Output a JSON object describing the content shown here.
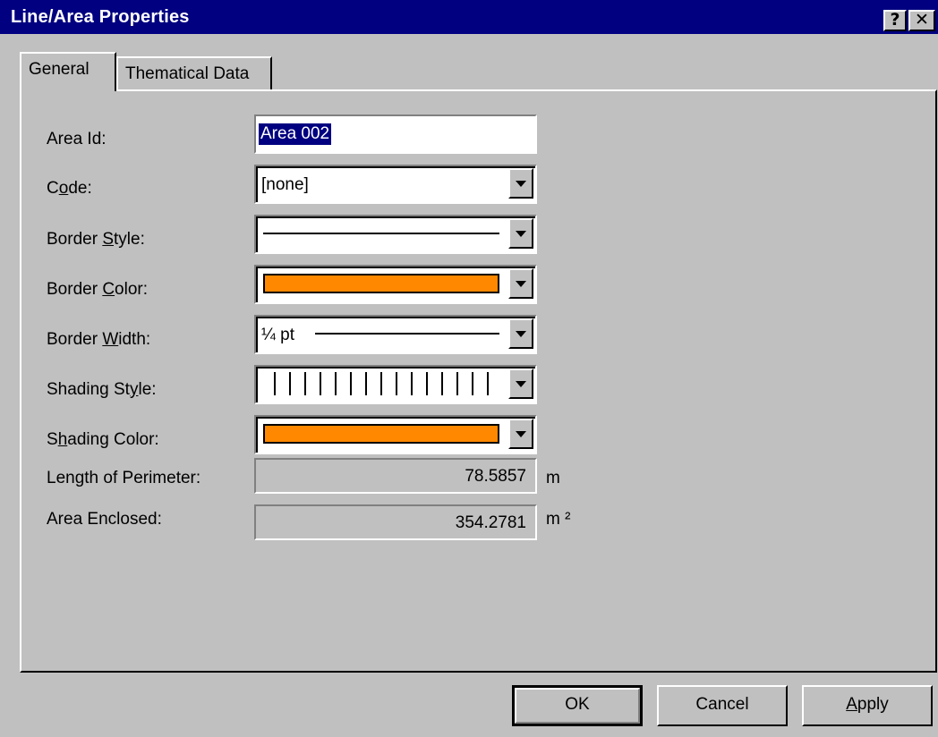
{
  "window": {
    "title": "Line/Area Properties",
    "help_label": "?",
    "close_label": "✕"
  },
  "tabs": [
    {
      "label": "General",
      "selected": true
    },
    {
      "label": "Thematical Data",
      "selected": false
    }
  ],
  "fields": {
    "area_id": {
      "label": "Area Id:",
      "value": "Area 002"
    },
    "code": {
      "label_pre": "C",
      "label_u": "o",
      "label_post": "de:",
      "value": "[none]"
    },
    "border_style": {
      "label_pre": "Border ",
      "label_u": "S",
      "label_post": "tyle:",
      "value": "solid"
    },
    "border_color": {
      "label_pre": "Border ",
      "label_u": "C",
      "label_post": "olor:",
      "color": "#ff8800"
    },
    "border_width": {
      "label_pre": "Border ",
      "label_u": "W",
      "label_post": "idth:",
      "value": "¼ pt"
    },
    "shading_style": {
      "label_pre": "Shading St",
      "label_u": "y",
      "label_post": "le:",
      "value": "vertical"
    },
    "shading_color": {
      "label_pre": "S",
      "label_u": "h",
      "label_post": "ading Color:",
      "color": "#ff8800"
    },
    "perimeter": {
      "label": "Length of Perimeter:",
      "value": "78.5857",
      "unit": "m"
    },
    "area": {
      "label": "Area Enclosed:",
      "value": "354.2781",
      "unit": "m ²"
    }
  },
  "buttons": {
    "ok": "OK",
    "cancel": "Cancel",
    "apply_pre": "",
    "apply_u": "A",
    "apply_post": "pply"
  }
}
